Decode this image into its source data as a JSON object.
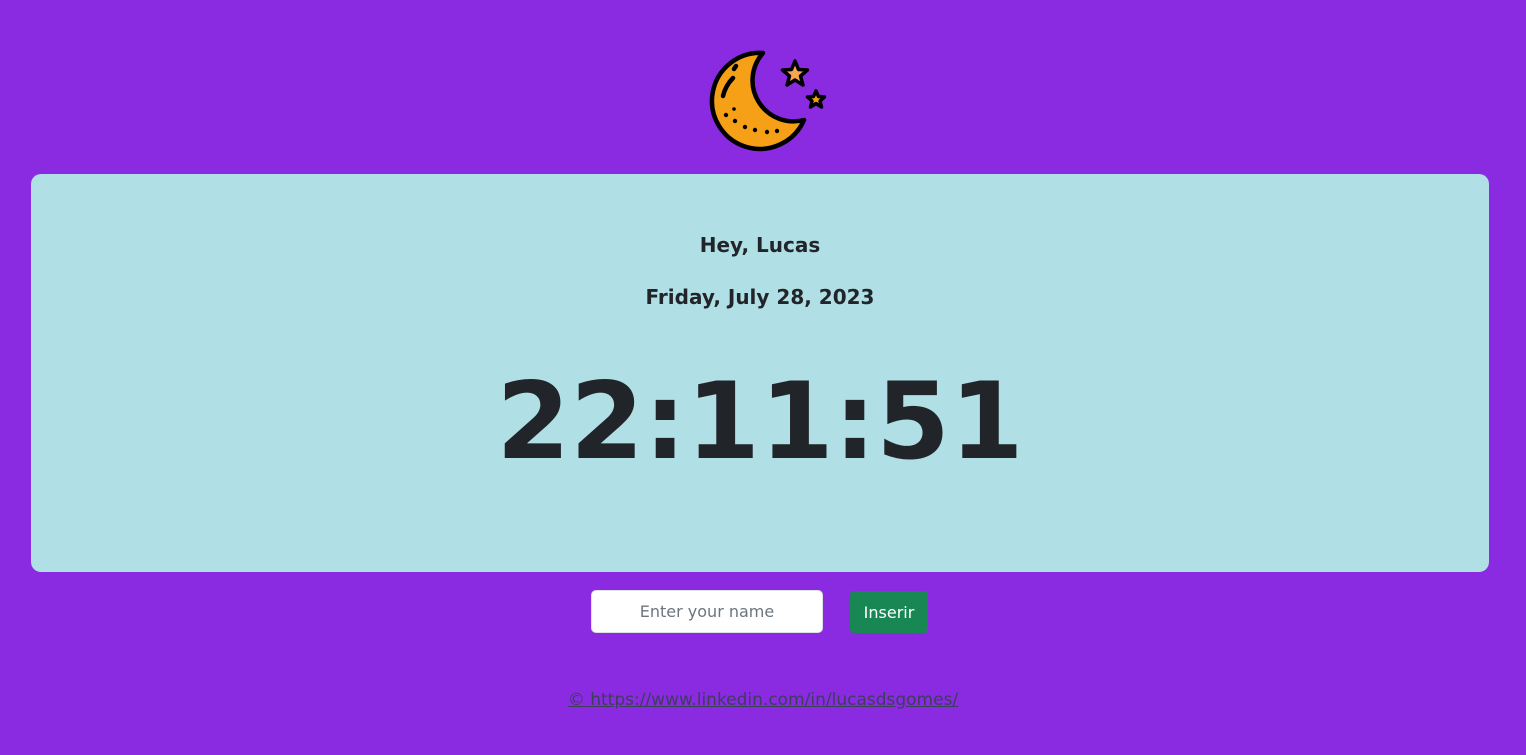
{
  "header": {
    "icon": "moon-stars-icon",
    "colors": {
      "moon": "#f5a016",
      "outline": "#000000",
      "star": "#f7a651"
    }
  },
  "card": {
    "greeting": "Hey, Lucas",
    "date": "Friday, July 28, 2023",
    "time": "22:11:51"
  },
  "form": {
    "name_placeholder": "Enter your name",
    "name_value": "",
    "submit_label": "Inserir"
  },
  "footer": {
    "link_text": "© https://www.linkedin.com/in/lucasdsgomes/"
  },
  "colors": {
    "page_background": "#8a2be2",
    "card_background": "#b0dfe5",
    "text": "#212529",
    "button": "#198754"
  }
}
